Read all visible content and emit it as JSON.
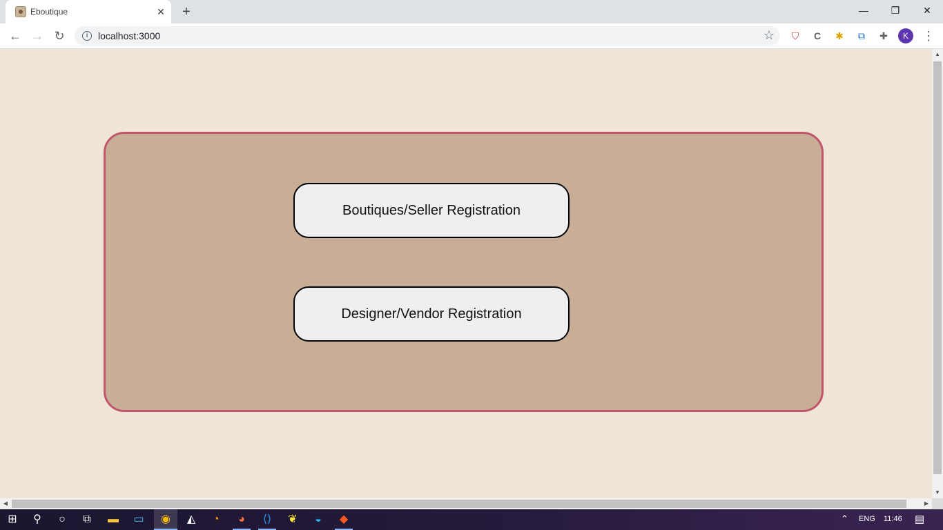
{
  "browser": {
    "tab_title": "Eboutique",
    "tab_close": "✕",
    "new_tab": "+",
    "url": "localhost:3000",
    "avatar_initial": "K",
    "window_minimize": "—",
    "window_restore": "❐",
    "window_close": "✕"
  },
  "page": {
    "buttons": {
      "boutique_seller": "Boutiques/Seller Registration",
      "designer_vendor": "Designer/Vendor Registration"
    },
    "colors": {
      "page_background": "#f0e4d7",
      "card_background": "#c8ae97",
      "card_border": "#c0566b",
      "button_background": "#efefef"
    }
  },
  "taskbar": {
    "language": "ENG",
    "time": "11:46"
  },
  "icons": {
    "back": "back-arrow-icon",
    "forward": "forward-arrow-icon",
    "reload": "reload-icon",
    "info": "info-icon",
    "bookmark": "star-icon",
    "extensions": "puzzle-icon",
    "menu": "three-dots-icon"
  }
}
